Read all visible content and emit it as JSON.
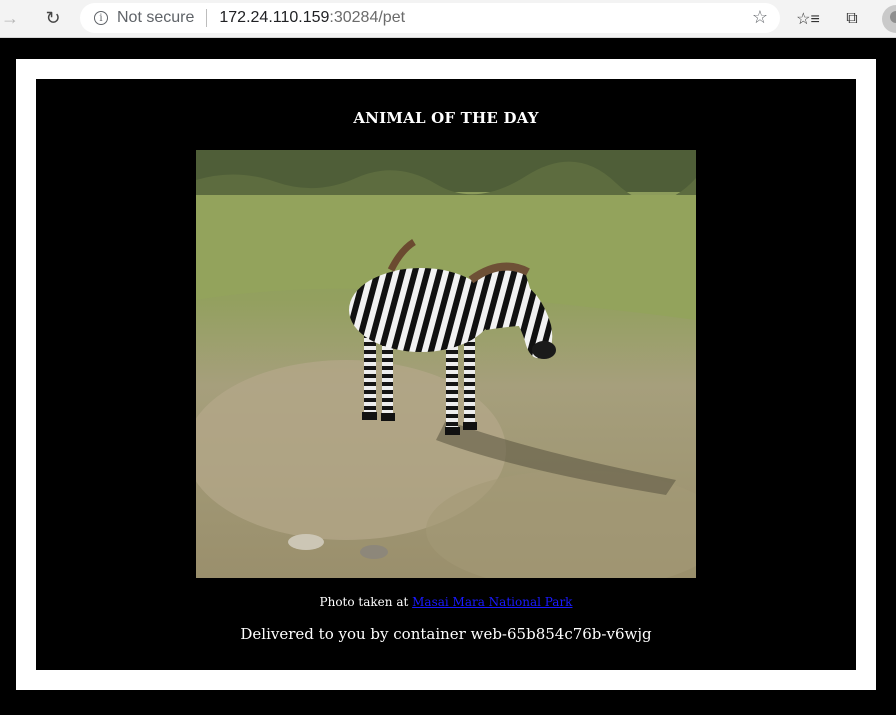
{
  "browser": {
    "security_label": "Not secure",
    "url_host": "172.24.110.159",
    "url_rest": ":30284/pet"
  },
  "page": {
    "title": "ANIMAL OF THE DAY",
    "photo_subject": "zebra",
    "caption_prefix": "Photo taken at",
    "caption_link": "Masai Mara National Park",
    "delivered_text": "Delivered to you by container web-65b854c76b-v6wjg"
  },
  "colors": {
    "panel_background": "#000000",
    "frame_background": "#ffffff",
    "link_color": "#1a1aff"
  }
}
